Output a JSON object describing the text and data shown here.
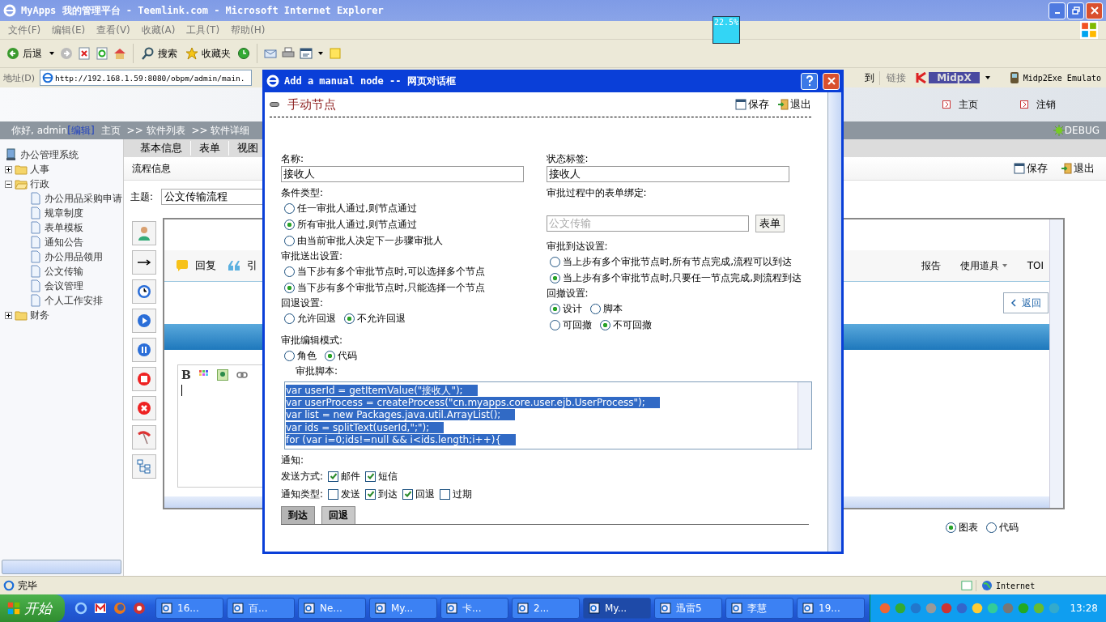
{
  "window": {
    "title": "MyApps 我的管理平台 - Teemlink.com - Microsoft Internet Explorer"
  },
  "menu": [
    "文件(F)",
    "编辑(E)",
    "查看(V)",
    "收藏(A)",
    "工具(T)",
    "帮助(H)"
  ],
  "toolbar": {
    "back": "后退",
    "search": "搜索",
    "favorites": "收藏夹"
  },
  "progress_badge": "22.5%",
  "address_bar": {
    "label": "地址(D)",
    "url": "http://192.168.1.59:8080/obpm/admin/main.",
    "go": "到",
    "links": "链接",
    "midpx": "MidpX",
    "emulator": "Midp2Exe Emulato"
  },
  "header": {
    "links": [
      "主页",
      "注销"
    ],
    "debug": "DEBUG"
  },
  "breadcrumb": {
    "greeting": "你好, admin",
    "edit": "[编辑]",
    "items": [
      "主页",
      ">> 软件列表",
      ">> 软件详细"
    ]
  },
  "tree": {
    "label": "办公管理系统",
    "children": [
      {
        "label": "人事",
        "kind": "folder",
        "expanded": false
      },
      {
        "label": "行政",
        "kind": "folder",
        "expanded": true,
        "children": [
          {
            "label": "办公用品采购申请",
            "kind": "page"
          },
          {
            "label": "规章制度",
            "kind": "page"
          },
          {
            "label": "表单模板",
            "kind": "page"
          },
          {
            "label": "通知公告",
            "kind": "page"
          },
          {
            "label": "办公用品领用",
            "kind": "page"
          },
          {
            "label": "公文传输",
            "kind": "page"
          },
          {
            "label": "会议管理",
            "kind": "page"
          },
          {
            "label": "个人工作安排",
            "kind": "page"
          }
        ]
      },
      {
        "label": "财务",
        "kind": "folder",
        "expanded": false
      }
    ]
  },
  "tabs": [
    "基本信息",
    "表单",
    "视图"
  ],
  "section": {
    "title": "流程信息",
    "actions": [
      "保存",
      "退出"
    ]
  },
  "subject": {
    "label": "主题:",
    "value": "公文传输流程"
  },
  "frame": {
    "toolbar_left": [
      "回复",
      "引"
    ],
    "toolbar_right": [
      "报告",
      "使用道具",
      "TOI"
    ],
    "back": "返回",
    "editor_bold": "B"
  },
  "view_mode": [
    {
      "label": "图表",
      "selected": true
    },
    {
      "label": "代码",
      "selected": false
    }
  ],
  "dialog": {
    "title": "Add a manual node -- 网页对话框",
    "heading": "手动节点",
    "actions": [
      "保存",
      "退出"
    ],
    "name": {
      "label": "名称:",
      "value": "接收人"
    },
    "status_label": {
      "label": "状态标签:",
      "value": "接收人"
    },
    "condition": {
      "label": "条件类型:",
      "options": [
        {
          "label": "任一审批人通过,则节点通过",
          "selected": false
        },
        {
          "label": "所有审批人通过,则节点通过",
          "selected": true
        },
        {
          "label": "由当前审批人决定下一步骤审批人",
          "selected": false
        }
      ]
    },
    "form_binding": {
      "label": "审批过程中的表单绑定:",
      "value": "公文传输",
      "disabled": true,
      "button": "表单"
    },
    "send_setting": {
      "label": "审批送出设置:",
      "options": [
        {
          "label": "当下步有多个审批节点时,可以选择多个节点",
          "selected": false
        },
        {
          "label": "当下步有多个审批节点时,只能选择一个节点",
          "selected": true
        }
      ]
    },
    "arrive_setting": {
      "label": "审批到达设置:",
      "options": [
        {
          "label": "当上步有多个审批节点时,所有节点完成,流程可以到达",
          "selected": false
        },
        {
          "label": "当上步有多个审批节点时,只要任一节点完成,则流程到达",
          "selected": true
        }
      ]
    },
    "rollback": {
      "label": "回退设置:",
      "options": [
        {
          "label": "允许回退",
          "selected": false
        },
        {
          "label": "不允许回退",
          "selected": true
        }
      ]
    },
    "withdraw": {
      "label": "回撤设置:",
      "options": [
        {
          "label": "设计",
          "selected": true
        },
        {
          "label": "脚本",
          "selected": false
        }
      ]
    },
    "withdraw_mode": {
      "options": [
        {
          "label": "可回撤",
          "selected": false
        },
        {
          "label": "不可回撤",
          "selected": true
        }
      ]
    },
    "edit_mode": {
      "label": "审批编辑模式:",
      "options": [
        {
          "label": "角色",
          "selected": false
        },
        {
          "label": "代码",
          "selected": true
        }
      ]
    },
    "script": {
      "label": "审批脚本:",
      "selected": true,
      "lines": [
        "var userId = getItemValue(\"接收人\");",
        "var userProcess = createProcess(\"cn.myapps.core.user.ejb.UserProcess\");",
        "var list = new Packages.java.util.ArrayList();",
        "var ids = splitText(userId,\";\");",
        "for (var i=0;ids!=null && i<ids.length;i++){"
      ]
    },
    "notify_label": "通知:",
    "send_methods": {
      "label": "发送方式:",
      "options": [
        {
          "label": "邮件",
          "checked": true
        },
        {
          "label": "短信",
          "checked": true
        }
      ]
    },
    "notify_types": {
      "label": "通知类型:",
      "options": [
        {
          "label": "发送",
          "checked": false
        },
        {
          "label": "到达",
          "checked": true
        },
        {
          "label": "回退",
          "checked": true
        },
        {
          "label": "过期",
          "checked": false
        }
      ]
    },
    "tabs": [
      {
        "label": "到达",
        "selected": true
      },
      {
        "label": "回退",
        "selected": false
      }
    ]
  },
  "status_bar": {
    "text": "完毕",
    "zone": "Internet"
  },
  "taskbar": {
    "start": "开始",
    "tasks": [
      {
        "label": "16...",
        "selected": false
      },
      {
        "label": "百...",
        "selected": false
      },
      {
        "label": "Ne...",
        "selected": false
      },
      {
        "label": "My...",
        "selected": false
      },
      {
        "label": "卡...",
        "selected": false
      },
      {
        "label": "2...",
        "selected": false
      },
      {
        "label": "My...",
        "selected": true
      },
      {
        "label": "迅雷5",
        "selected": false
      },
      {
        "label": "李慧",
        "selected": false
      },
      {
        "label": "19...",
        "selected": false
      }
    ],
    "clock": "13:28"
  }
}
